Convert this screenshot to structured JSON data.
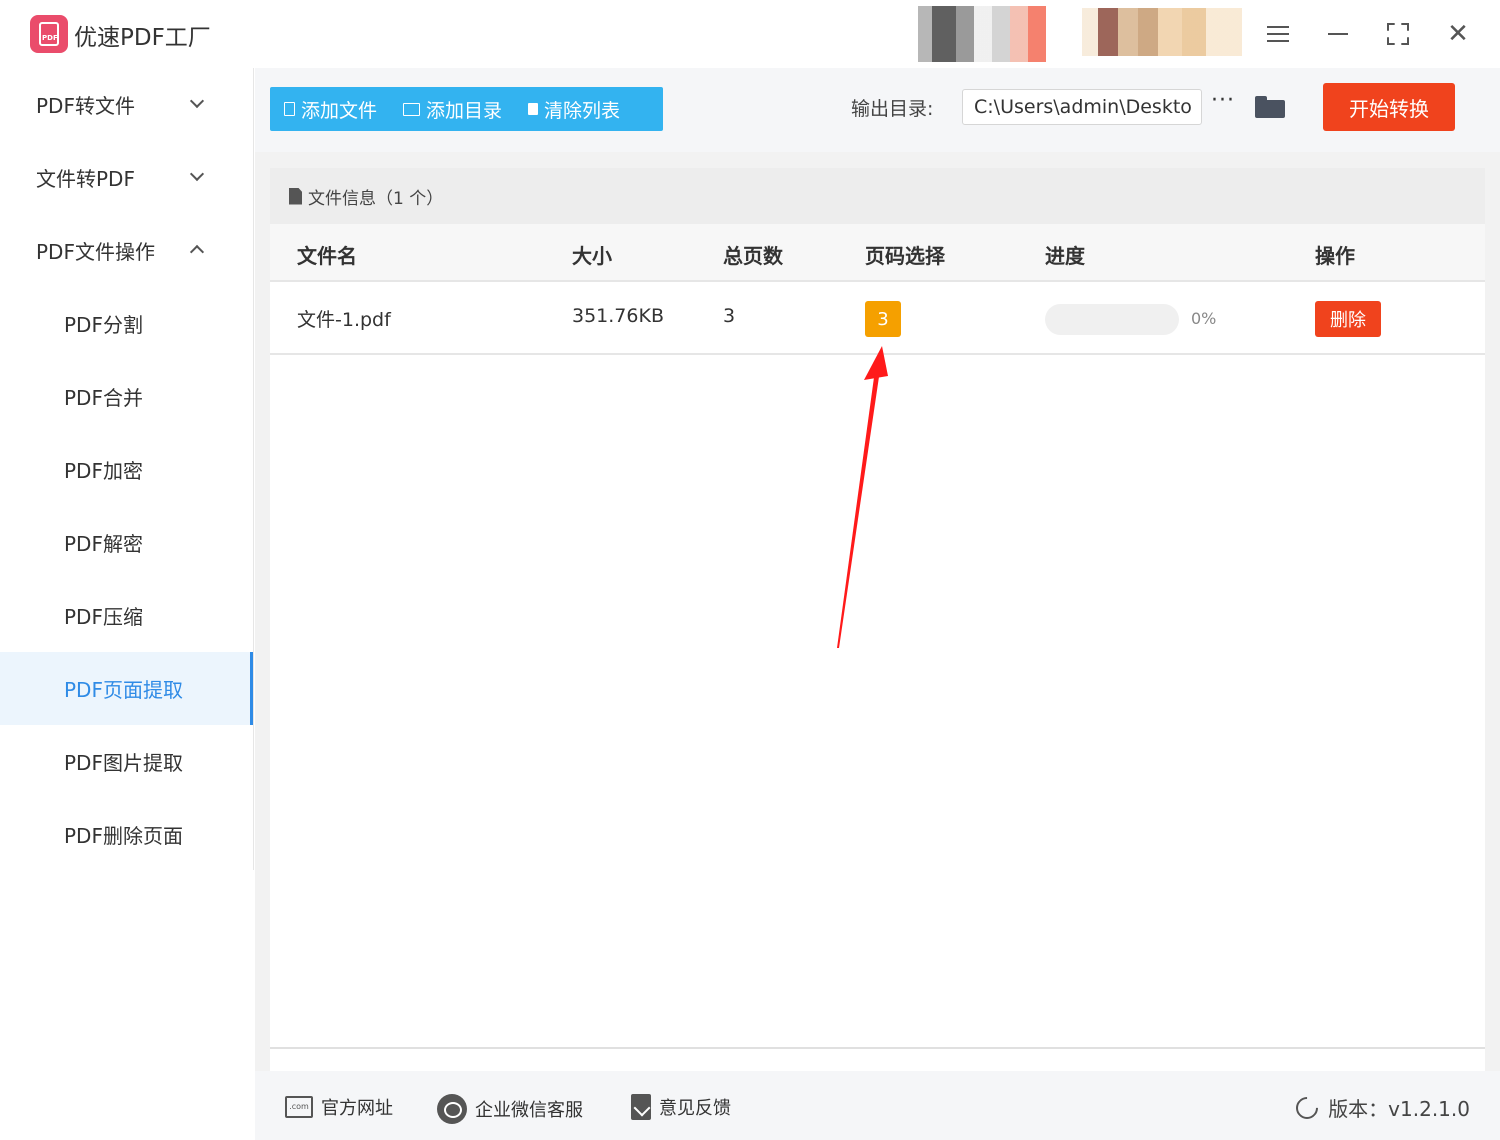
{
  "app": {
    "title": "优速PDF工厂",
    "logo_text": "PDF"
  },
  "window": {
    "menu_icon": "menu-icon",
    "minimize_icon": "minimize-icon",
    "maximize_icon": "maximize-icon",
    "close_icon": "close-icon",
    "close_glyph": "✕"
  },
  "sidebar": {
    "groups": [
      {
        "label": "PDF转文件",
        "expanded": false
      },
      {
        "label": "文件转PDF",
        "expanded": false
      },
      {
        "label": "PDF文件操作",
        "expanded": true
      }
    ],
    "items": [
      {
        "label": "PDF分割"
      },
      {
        "label": "PDF合并"
      },
      {
        "label": "PDF加密"
      },
      {
        "label": "PDF解密"
      },
      {
        "label": "PDF压缩"
      },
      {
        "label": "PDF页面提取",
        "active": true
      },
      {
        "label": "PDF图片提取"
      },
      {
        "label": "PDF删除页面"
      }
    ]
  },
  "toolbar": {
    "add_file": "添加文件",
    "add_dir": "添加目录",
    "clear_list": "清除列表",
    "output_label": "输出目录:",
    "output_path": "C:\\Users\\admin\\Deskto",
    "more": "···",
    "start": "开始转换"
  },
  "panel": {
    "header": "文件信息（1 个）",
    "columns": [
      "文件名",
      "大小",
      "总页数",
      "页码选择",
      "进度",
      "操作"
    ],
    "rows": [
      {
        "name": "文件-1.pdf",
        "size": "351.76KB",
        "pages": "3",
        "page_select": "3",
        "progress_percent": 0,
        "progress_text": "0%",
        "action": "删除"
      }
    ]
  },
  "footer": {
    "website": "官方网址",
    "wechat": "企业微信客服",
    "feedback": "意见反馈",
    "version": "版本：v1.2.1.0",
    "website_icon_text": ".com"
  },
  "colors": {
    "accent": "#33b3f0",
    "start": "#f0431d",
    "badge": "#f5a000",
    "active": "#2f8be6",
    "annotation": "#ff1a1a"
  }
}
